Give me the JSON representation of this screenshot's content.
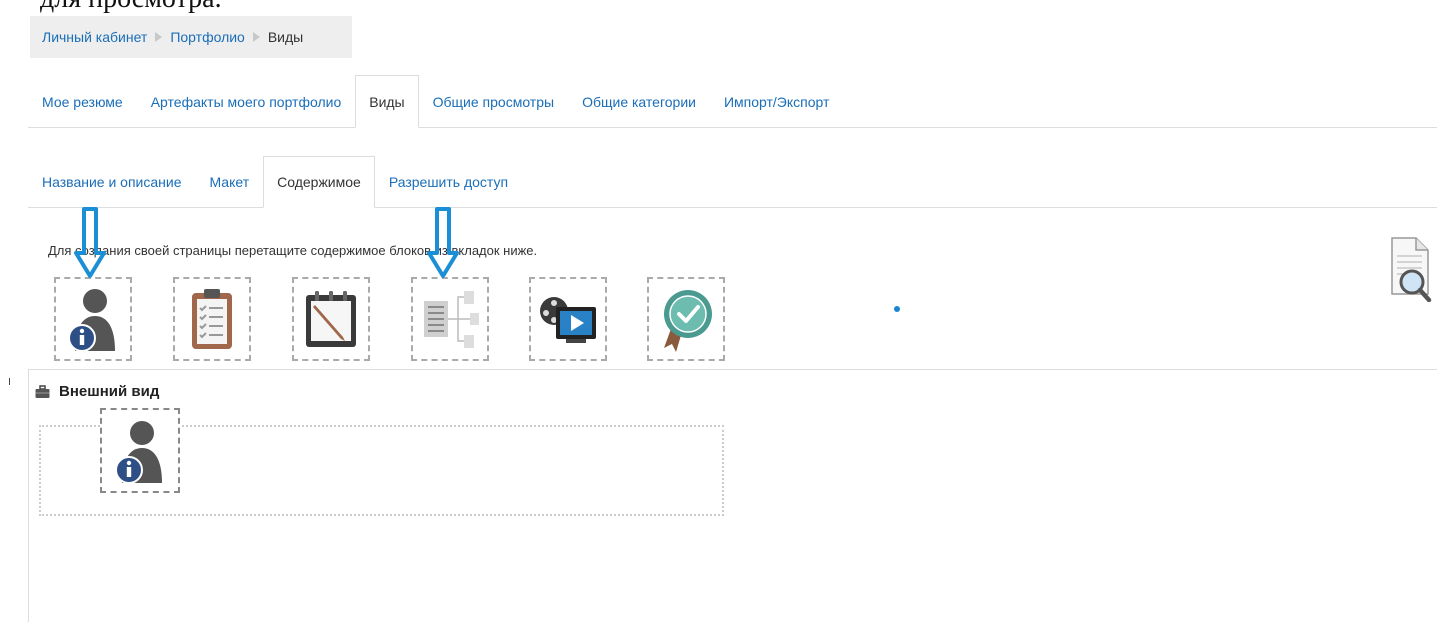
{
  "top_cut_text": "для просмотра.",
  "breadcrumb": {
    "items": [
      {
        "label": "Личный кабинет",
        "link": true
      },
      {
        "label": "Портфолио",
        "link": true
      },
      {
        "label": "Виды",
        "link": false
      }
    ]
  },
  "main_tabs": [
    {
      "label": "Мое резюме",
      "active": false
    },
    {
      "label": "Артефакты моего портфолио",
      "active": false
    },
    {
      "label": "Виды",
      "active": true
    },
    {
      "label": "Общие просмотры",
      "active": false
    },
    {
      "label": "Общие категории",
      "active": false
    },
    {
      "label": "Импорт/Экспорт",
      "active": false
    }
  ],
  "sub_tabs": [
    {
      "label": "Название и описание",
      "active": false
    },
    {
      "label": "Макет",
      "active": false
    },
    {
      "label": "Содержимое",
      "active": true
    },
    {
      "label": "Разрешить доступ",
      "active": false
    }
  ],
  "instructions": "Для создания своей страницы перетащите содержимое блоков из вкладок ниже.",
  "palette": [
    {
      "icon": "profile-info-icon"
    },
    {
      "icon": "clipboard-checklist-icon"
    },
    {
      "icon": "notepad-pen-icon"
    },
    {
      "icon": "tree-diagram-icon"
    },
    {
      "icon": "film-video-icon"
    },
    {
      "icon": "badge-check-icon"
    }
  ],
  "section": {
    "heading": "Внешний вид",
    "icon": "briefcase-icon"
  },
  "colors": {
    "link": "#1a6eb8",
    "arrow": "#1a8fd6",
    "tab_border": "#dddddd"
  }
}
